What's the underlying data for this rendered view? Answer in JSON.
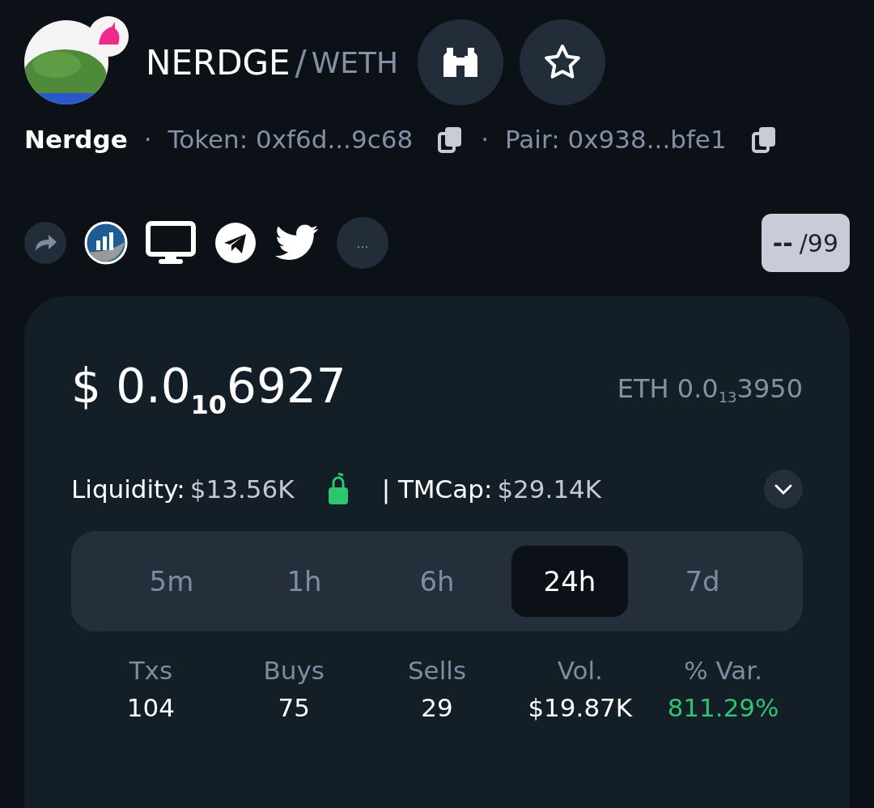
{
  "header": {
    "name": "NERDGE",
    "separator": "/",
    "quote": "WETH"
  },
  "info": {
    "token_name": "Nerdge",
    "dot_1": "·",
    "token": "Token: 0xf6d...9c68",
    "dot_2": "·",
    "pair": "Pair: 0x938...bfe1"
  },
  "links": {
    "more": "...",
    "score_value": "--",
    "score_max": "/99"
  },
  "price": {
    "usd": "$ 0.0$_{10}$6927",
    "eth": "ETH 0.0$_{13}$3950"
  },
  "stats_line": {
    "liquidity_label": "Liquidity:",
    "liquidity_value": "$13.56K",
    "locked": true,
    "tmcap_label": "| TMCap:",
    "tmcap_value": "$29.14K"
  },
  "tabs": [
    {
      "label": "5m",
      "selected": false
    },
    {
      "label": "1h",
      "selected": false
    },
    {
      "label": "6h",
      "selected": false
    },
    {
      "label": "24h",
      "selected": true
    },
    {
      "label": "7d",
      "selected": false
    }
  ],
  "metrics": [
    {
      "label": "Txs",
      "value": "104",
      "color": "#ffffff"
    },
    {
      "label": "Buys",
      "value": "75",
      "color": "#ffffff"
    },
    {
      "label": "Sells",
      "value": "29",
      "color": "#ffffff"
    },
    {
      "label": "Vol.",
      "value": "$19.87K",
      "color": "#ffffff"
    },
    {
      "label": "% Var.",
      "value": "811.29%",
      "color": "#2fc46e"
    }
  ]
}
